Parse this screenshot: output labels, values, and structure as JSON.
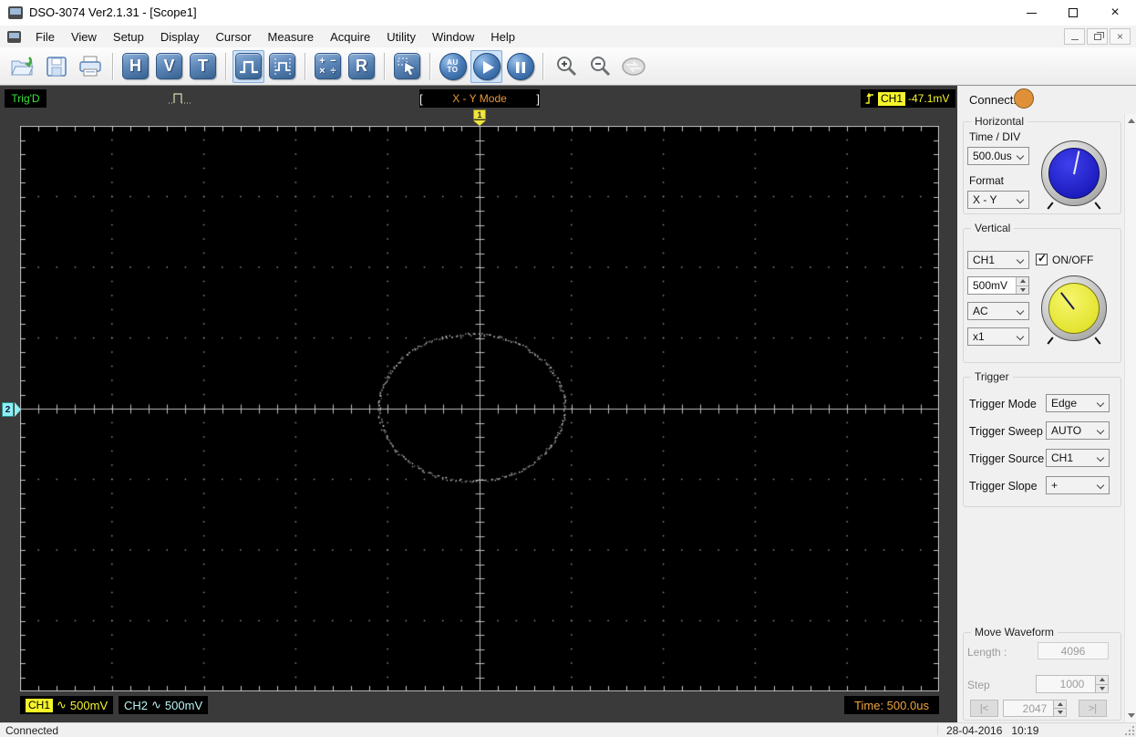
{
  "window": {
    "title": "DSO-3074 Ver2.1.31 - [Scope1]",
    "controls": [
      "minimize",
      "maximize",
      "restore-group"
    ],
    "close_glyph": "×"
  },
  "menu": {
    "items": [
      "File",
      "View",
      "Setup",
      "Display",
      "Cursor",
      "Measure",
      "Acquire",
      "Utility",
      "Window",
      "Help"
    ]
  },
  "toolbar": {
    "buttons": [
      {
        "name": "open"
      },
      {
        "name": "save"
      },
      {
        "name": "print"
      },
      {
        "name": "horizontal-settings",
        "label": "H"
      },
      {
        "name": "vertical-settings",
        "label": "V"
      },
      {
        "name": "trigger-settings",
        "label": "T"
      },
      {
        "name": "pulse",
        "selected": true
      },
      {
        "name": "pulse-measure"
      },
      {
        "name": "math",
        "symbols": [
          "+",
          "−",
          "×",
          "÷"
        ]
      },
      {
        "name": "refresh",
        "label": "R"
      },
      {
        "name": "cursor"
      },
      {
        "name": "auto",
        "label_top": "AU",
        "label_bottom": "TO"
      },
      {
        "name": "run",
        "selected": true
      },
      {
        "name": "pause"
      },
      {
        "name": "zoom-in"
      },
      {
        "name": "zoom-out"
      },
      {
        "name": "transfer",
        "disabled": true
      }
    ]
  },
  "scope": {
    "trig_status": "Trig'D",
    "mode": "X - Y Mode",
    "bracket_left": "[",
    "bracket_right": "]",
    "trigger_readout": {
      "channel": "CH1",
      "value": "-47.1mV"
    },
    "marker_top": "1",
    "marker_left": "2",
    "ch1": {
      "label": "CH1",
      "coupling_symbol": "∿",
      "scale": "500mV"
    },
    "ch2": {
      "label": "CH2",
      "coupling_symbol": "∿",
      "scale": "500mV"
    },
    "time_readout": "Time: 500.0us",
    "display": {
      "h_divisions": 10,
      "v_divisions": 8,
      "minor_per_div": 5,
      "bg": "#000000",
      "frame_color": "#c6c6c6",
      "grid_color": "#9c9c9c",
      "axis_color": "#bdbdbd",
      "trace": {
        "type": "xy_ellipse",
        "cx_div": -0.09,
        "cy_div": -0.02,
        "rx_div": 1.01,
        "ry_div": 1.04,
        "color": "#d6d6d6",
        "points": 330
      }
    }
  },
  "panel": {
    "connect_label": "Connect:",
    "connect_color": "#e09038",
    "horizontal": {
      "title": "Horizontal",
      "time_div_label": "Time / DIV",
      "time_div_value": "500.0us",
      "format_label": "Format",
      "format_value": "X - Y",
      "knob_angle_deg": 12,
      "knob_color": "#2020cd"
    },
    "vertical": {
      "title": "Vertical",
      "channel_value": "CH1",
      "onoff_label": "ON/OFF",
      "onoff_checked": true,
      "check_glyph": "✓",
      "volts_value": "500mV",
      "coupling_value": "AC",
      "probe_value": "x1",
      "knob_angle_deg": -38,
      "knob_color": "#e4e432"
    },
    "trigger": {
      "title": "Trigger",
      "rows": [
        {
          "label": "Trigger Mode",
          "value": "Edge"
        },
        {
          "label": "Trigger Sweep",
          "value": "AUTO"
        },
        {
          "label": "Trigger Source",
          "value": "CH1"
        },
        {
          "label": "Trigger Slope",
          "value": "+"
        }
      ]
    },
    "move_waveform": {
      "title": "Move Waveform",
      "length_label": "Length :",
      "length_value": "4096",
      "step_label": "Step",
      "step_value": "1000",
      "position_value": "2047",
      "first_label": "|<",
      "last_label": ">|"
    }
  },
  "statusbar": {
    "left": "Connected",
    "right": "28-04-2016   10:19"
  }
}
